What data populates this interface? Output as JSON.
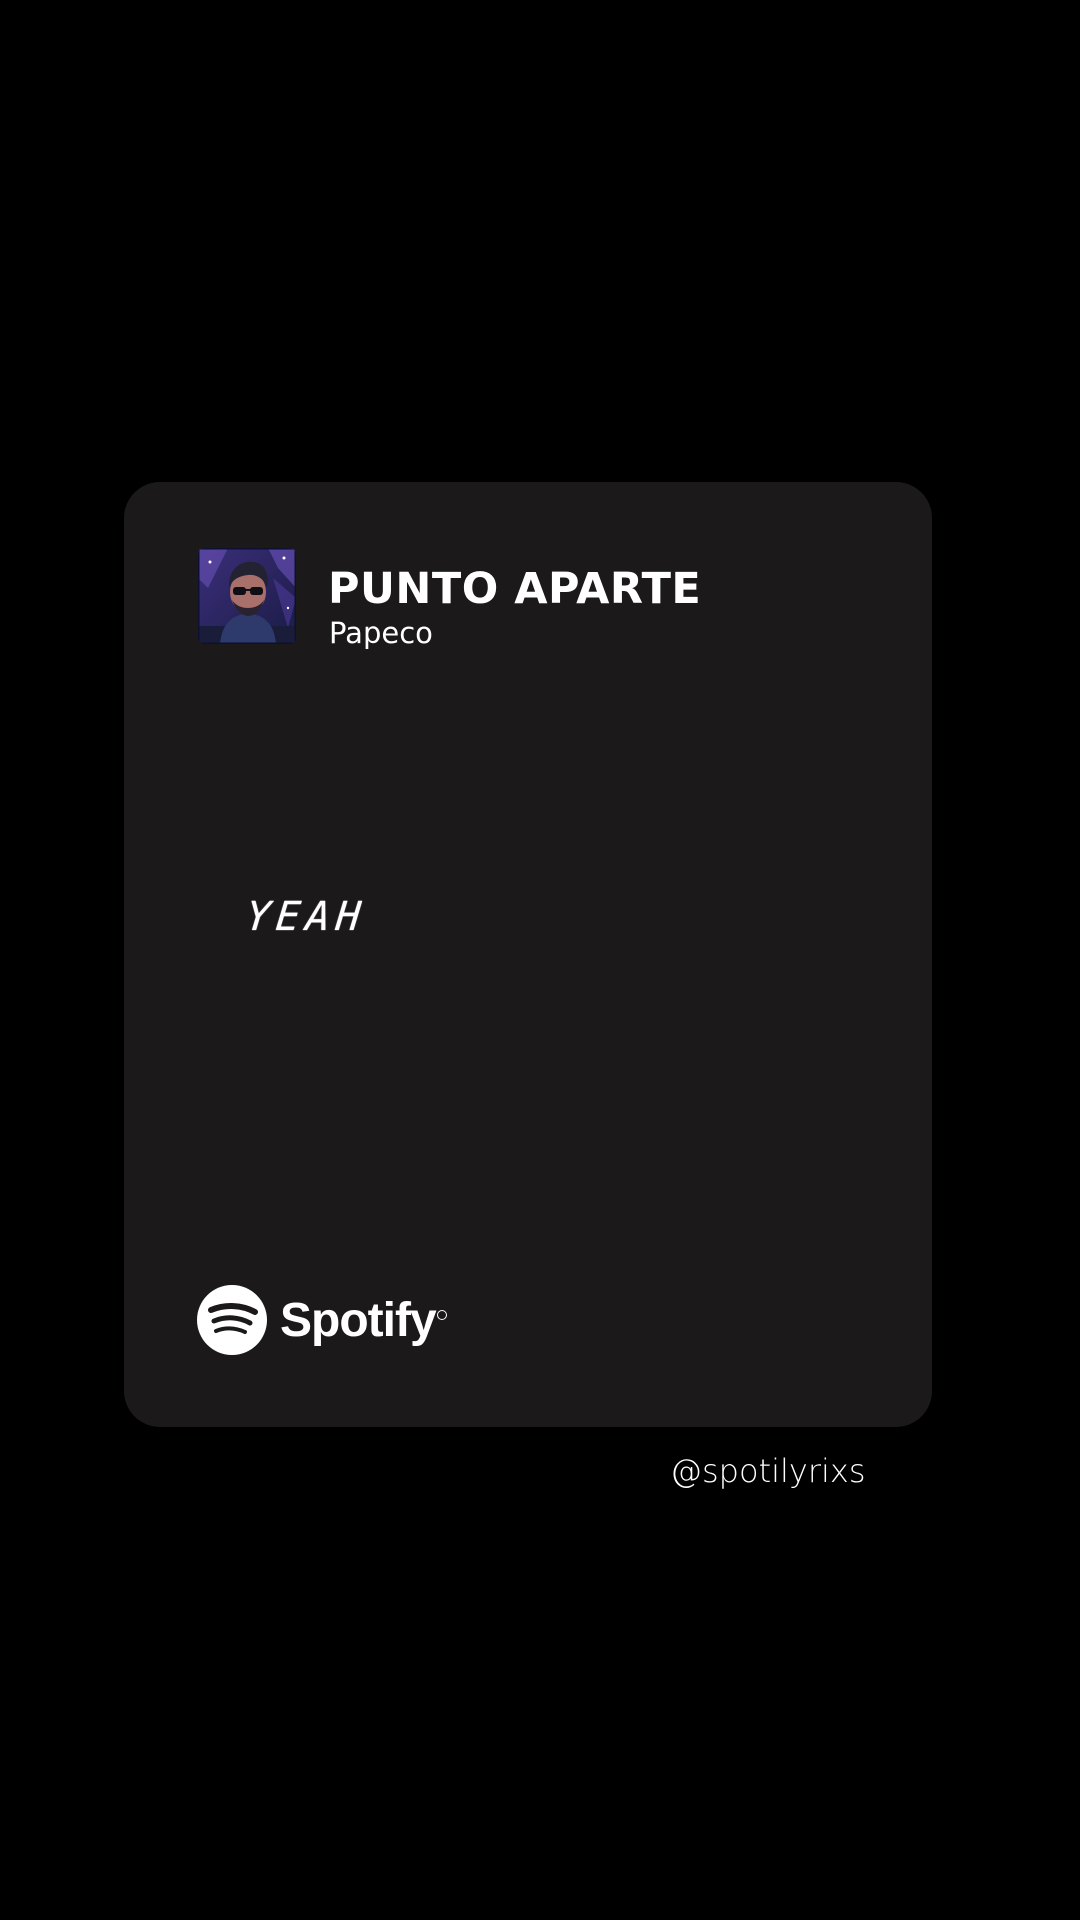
{
  "song": {
    "title": "PUNTO APARTE",
    "artist": "Papeco",
    "cover_icon": "album-cover-image"
  },
  "lyric": {
    "text": "YEAH"
  },
  "brand": {
    "name": "Spotify",
    "icon": "spotify-logo-icon"
  },
  "watermark": {
    "handle": "@spotilyrixs"
  },
  "colors": {
    "background": "#000000",
    "card": "#1c191a",
    "text": "#ffffff"
  }
}
